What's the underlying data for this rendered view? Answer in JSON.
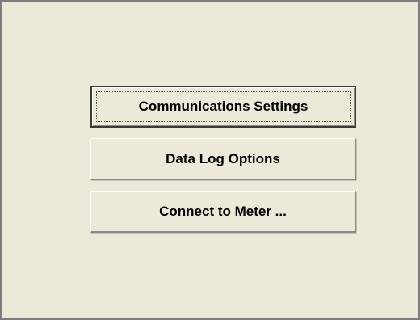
{
  "buttons": {
    "communications_settings": "Communications Settings",
    "data_log_options": "Data Log Options",
    "connect_to_meter": "Connect to Meter ..."
  },
  "colors": {
    "window_background": "#ece9d8",
    "window_border": "#7d7d7d",
    "button_text": "#000000"
  }
}
